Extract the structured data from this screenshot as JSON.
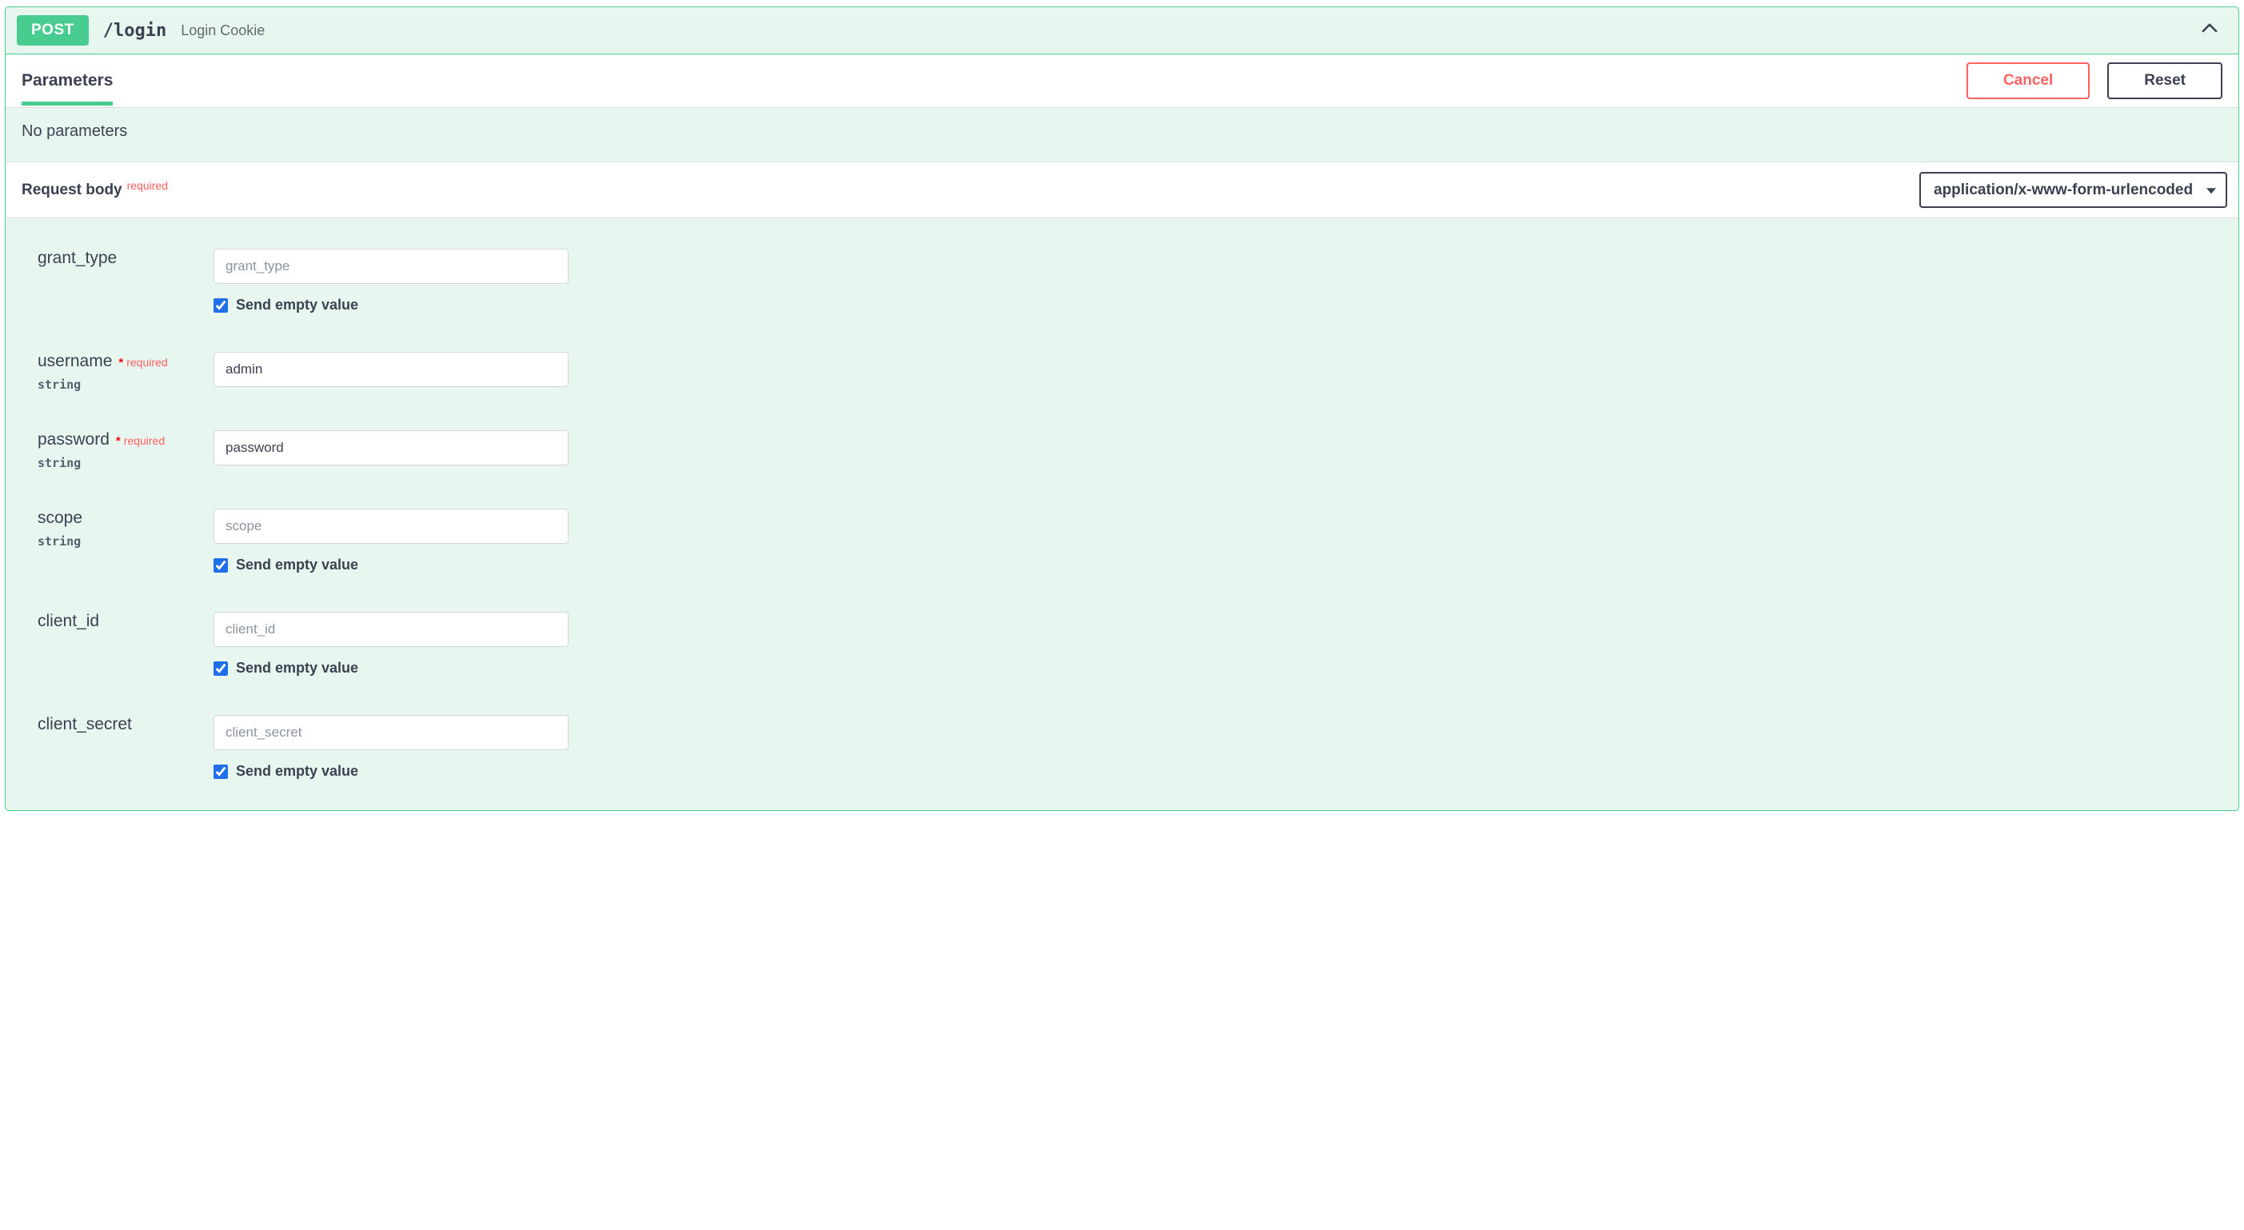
{
  "op": {
    "method": "POST",
    "path": "/login",
    "summary": "Login Cookie"
  },
  "tabs": {
    "parameters": "Parameters"
  },
  "buttons": {
    "cancel": "Cancel",
    "reset": "Reset"
  },
  "parameters": {
    "none_text": "No parameters"
  },
  "request_body": {
    "title": "Request body",
    "required_tag": "required",
    "content_type": "application/x-www-form-urlencoded"
  },
  "labels": {
    "required_star": "*",
    "required_text": "required",
    "send_empty": "Send empty value",
    "type_string": "string"
  },
  "fields": {
    "grant_type": {
      "name": "grant_type",
      "placeholder": "grant_type",
      "value": "",
      "send_empty": true,
      "required": false,
      "type": ""
    },
    "username": {
      "name": "username",
      "placeholder": "username",
      "value": "admin",
      "required": true,
      "type": "string"
    },
    "password": {
      "name": "password",
      "placeholder": "password",
      "value": "password",
      "required": true,
      "type": "string"
    },
    "scope": {
      "name": "scope",
      "placeholder": "scope",
      "value": "",
      "send_empty": true,
      "required": false,
      "type": "string"
    },
    "client_id": {
      "name": "client_id",
      "placeholder": "client_id",
      "value": "",
      "send_empty": true,
      "required": false,
      "type": ""
    },
    "client_secret": {
      "name": "client_secret",
      "placeholder": "client_secret",
      "value": "",
      "send_empty": true,
      "required": false,
      "type": ""
    }
  }
}
